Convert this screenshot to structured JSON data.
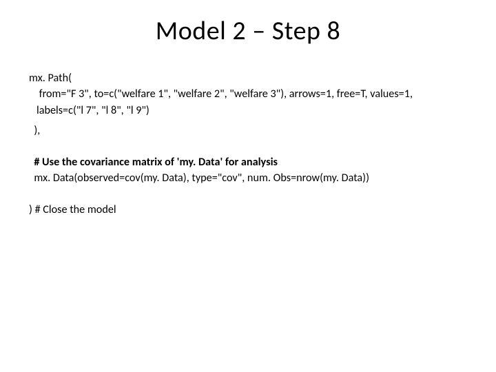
{
  "title": "Model 2 – Step 8",
  "code": {
    "l1": "mx. Path(",
    "l2": "    from=\"F 3\", to=c(\"welfare 1\", \"welfare 2\", \"welfare 3\"), arrows=1, free=T, values=1,",
    "l3": "   labels=c(\"l 7\", \"l 8\", \"l 9\")",
    "l4": "  ),",
    "l5": "  # Use the covariance matrix of 'my. Data' for analysis",
    "l6": "  mx. Data(observed=cov(my. Data), type=\"cov\", num. Obs=nrow(my. Data))",
    "l7": ") # Close the model"
  }
}
